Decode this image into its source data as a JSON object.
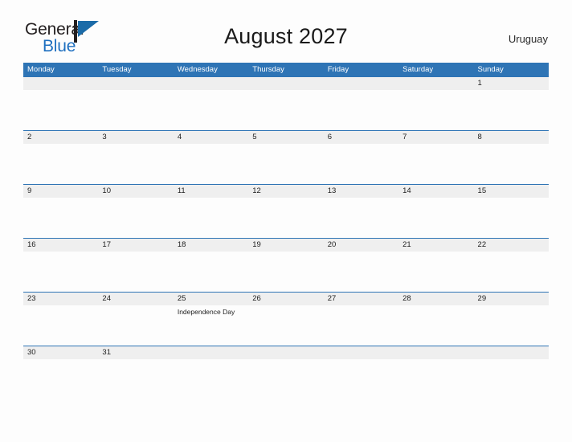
{
  "brand": {
    "name_part1": "General",
    "name_part2": "Blue",
    "flag_icon": "blue-triangle-flag-icon",
    "accent_color": "#1f70c0"
  },
  "header": {
    "title": "August 2027",
    "country": "Uruguay",
    "header_bar_color": "#2e74b5",
    "number_strip_color": "#efefef"
  },
  "calendar": {
    "weekdays": [
      "Monday",
      "Tuesday",
      "Wednesday",
      "Thursday",
      "Friday",
      "Saturday",
      "Sunday"
    ],
    "weeks": [
      {
        "days": [
          {
            "number": "",
            "event": ""
          },
          {
            "number": "",
            "event": ""
          },
          {
            "number": "",
            "event": ""
          },
          {
            "number": "",
            "event": ""
          },
          {
            "number": "",
            "event": ""
          },
          {
            "number": "",
            "event": ""
          },
          {
            "number": "1",
            "event": ""
          }
        ]
      },
      {
        "days": [
          {
            "number": "2",
            "event": ""
          },
          {
            "number": "3",
            "event": ""
          },
          {
            "number": "4",
            "event": ""
          },
          {
            "number": "5",
            "event": ""
          },
          {
            "number": "6",
            "event": ""
          },
          {
            "number": "7",
            "event": ""
          },
          {
            "number": "8",
            "event": ""
          }
        ]
      },
      {
        "days": [
          {
            "number": "9",
            "event": ""
          },
          {
            "number": "10",
            "event": ""
          },
          {
            "number": "11",
            "event": ""
          },
          {
            "number": "12",
            "event": ""
          },
          {
            "number": "13",
            "event": ""
          },
          {
            "number": "14",
            "event": ""
          },
          {
            "number": "15",
            "event": ""
          }
        ]
      },
      {
        "days": [
          {
            "number": "16",
            "event": ""
          },
          {
            "number": "17",
            "event": ""
          },
          {
            "number": "18",
            "event": ""
          },
          {
            "number": "19",
            "event": ""
          },
          {
            "number": "20",
            "event": ""
          },
          {
            "number": "21",
            "event": ""
          },
          {
            "number": "22",
            "event": ""
          }
        ]
      },
      {
        "days": [
          {
            "number": "23",
            "event": ""
          },
          {
            "number": "24",
            "event": ""
          },
          {
            "number": "25",
            "event": "Independence Day"
          },
          {
            "number": "26",
            "event": ""
          },
          {
            "number": "27",
            "event": ""
          },
          {
            "number": "28",
            "event": ""
          },
          {
            "number": "29",
            "event": ""
          }
        ]
      },
      {
        "days": [
          {
            "number": "30",
            "event": ""
          },
          {
            "number": "31",
            "event": ""
          },
          {
            "number": "",
            "event": ""
          },
          {
            "number": "",
            "event": ""
          },
          {
            "number": "",
            "event": ""
          },
          {
            "number": "",
            "event": ""
          },
          {
            "number": "",
            "event": ""
          }
        ]
      }
    ]
  }
}
